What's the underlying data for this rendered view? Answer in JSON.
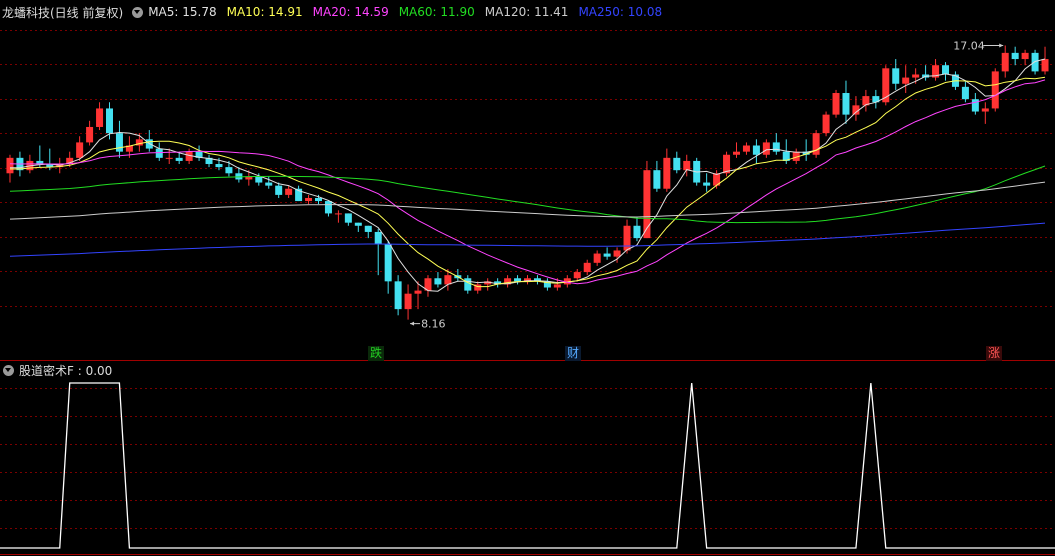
{
  "header": {
    "title": "龙蟠科技(日线 前复权)",
    "ma": [
      {
        "label": "MA5: 15.78",
        "color": "#e0e0e0"
      },
      {
        "label": "MA10: 14.91",
        "color": "#ffff55"
      },
      {
        "label": "MA20: 14.59",
        "color": "#ff44ff"
      },
      {
        "label": "MA60: 11.90",
        "color": "#22dd22"
      },
      {
        "label": "MA120: 11.41",
        "color": "#cccccc"
      },
      {
        "label": "MA250: 10.08",
        "color": "#3344ff"
      }
    ]
  },
  "annotations": {
    "high_label": "17.04",
    "low_label": "8.16"
  },
  "signals": [
    {
      "label": "跌",
      "color": "#22cc22",
      "bg": "#0a2a0a"
    },
    {
      "label": "财",
      "color": "#55aaff",
      "bg": "#0a1a30"
    },
    {
      "label": "涨",
      "color": "#ff5555",
      "bg": "#3a0a0a"
    }
  ],
  "indicator": {
    "title": "股道密术F : 0.00"
  },
  "colors": {
    "up": "#ff3333",
    "down": "#44e0f0",
    "grid": "#7a0000",
    "indicator_line": "#ffffff"
  },
  "chart_data": {
    "type": "candlestick",
    "candles": [
      [
        12.9,
        13.5,
        12.6,
        13.4
      ],
      [
        13.4,
        13.6,
        12.8,
        13.0
      ],
      [
        13.0,
        13.5,
        12.9,
        13.3
      ],
      [
        13.3,
        13.8,
        13.1,
        13.2
      ],
      [
        13.2,
        13.7,
        13.0,
        13.1
      ],
      [
        13.1,
        13.4,
        12.9,
        13.2
      ],
      [
        13.2,
        13.6,
        13.1,
        13.4
      ],
      [
        13.4,
        14.1,
        13.3,
        13.9
      ],
      [
        13.9,
        14.6,
        13.8,
        14.4
      ],
      [
        14.4,
        15.2,
        14.3,
        15.0
      ],
      [
        15.0,
        15.2,
        14.0,
        14.2
      ],
      [
        14.2,
        14.6,
        13.4,
        13.6
      ],
      [
        13.6,
        14.1,
        13.4,
        13.8
      ],
      [
        13.8,
        14.2,
        13.6,
        14.0
      ],
      [
        14.0,
        14.3,
        13.6,
        13.7
      ],
      [
        13.7,
        13.9,
        13.3,
        13.4
      ],
      [
        13.4,
        13.7,
        13.2,
        13.4
      ],
      [
        13.4,
        13.6,
        13.2,
        13.3
      ],
      [
        13.3,
        13.7,
        13.2,
        13.6
      ],
      [
        13.6,
        13.8,
        13.3,
        13.4
      ],
      [
        13.4,
        13.5,
        13.1,
        13.2
      ],
      [
        13.2,
        13.4,
        13.0,
        13.1
      ],
      [
        13.1,
        13.3,
        12.8,
        12.9
      ],
      [
        12.9,
        13.1,
        12.6,
        12.7
      ],
      [
        12.7,
        13.0,
        12.5,
        12.8
      ],
      [
        12.8,
        12.9,
        12.5,
        12.6
      ],
      [
        12.6,
        12.8,
        12.4,
        12.5
      ],
      [
        12.5,
        12.6,
        12.1,
        12.2
      ],
      [
        12.2,
        12.5,
        12.1,
        12.4
      ],
      [
        12.4,
        12.5,
        12.0,
        12.0
      ],
      [
        12.0,
        12.2,
        11.9,
        12.1
      ],
      [
        12.1,
        12.2,
        11.9,
        12.0
      ],
      [
        12.0,
        12.0,
        11.5,
        11.6
      ],
      [
        11.6,
        11.7,
        11.3,
        11.6
      ],
      [
        11.6,
        11.6,
        11.2,
        11.3
      ],
      [
        11.3,
        11.3,
        11.0,
        11.2
      ],
      [
        11.2,
        11.2,
        10.8,
        11.0
      ],
      [
        11.0,
        11.1,
        9.6,
        10.6
      ],
      [
        10.6,
        10.7,
        9.0,
        9.4
      ],
      [
        9.4,
        9.6,
        8.3,
        8.5
      ],
      [
        8.5,
        9.3,
        8.16,
        9.0
      ],
      [
        9.0,
        9.4,
        8.5,
        9.1
      ],
      [
        9.1,
        9.6,
        8.9,
        9.5
      ],
      [
        9.5,
        9.7,
        9.2,
        9.3
      ],
      [
        9.3,
        9.8,
        9.1,
        9.6
      ],
      [
        9.6,
        9.8,
        9.4,
        9.5
      ],
      [
        9.5,
        9.6,
        9.0,
        9.1
      ],
      [
        9.1,
        9.4,
        9.0,
        9.3
      ],
      [
        9.3,
        9.5,
        9.1,
        9.4
      ],
      [
        9.4,
        9.5,
        9.2,
        9.3
      ],
      [
        9.3,
        9.6,
        9.2,
        9.5
      ],
      [
        9.5,
        9.6,
        9.3,
        9.4
      ],
      [
        9.4,
        9.6,
        9.3,
        9.5
      ],
      [
        9.5,
        9.6,
        9.3,
        9.4
      ],
      [
        9.4,
        9.5,
        9.1,
        9.2
      ],
      [
        9.2,
        9.5,
        9.1,
        9.3
      ],
      [
        9.3,
        9.6,
        9.2,
        9.5
      ],
      [
        9.5,
        9.8,
        9.4,
        9.7
      ],
      [
        9.7,
        10.1,
        9.6,
        10.0
      ],
      [
        10.0,
        10.4,
        9.9,
        10.3
      ],
      [
        10.3,
        10.5,
        10.1,
        10.2
      ],
      [
        10.2,
        10.5,
        10.0,
        10.4
      ],
      [
        10.4,
        11.4,
        10.3,
        11.2
      ],
      [
        11.2,
        11.5,
        10.7,
        10.8
      ],
      [
        10.8,
        13.3,
        10.8,
        13.0
      ],
      [
        13.0,
        13.3,
        12.3,
        12.4
      ],
      [
        12.4,
        13.7,
        12.3,
        13.4
      ],
      [
        13.4,
        13.6,
        12.9,
        13.0
      ],
      [
        13.0,
        13.5,
        12.8,
        13.3
      ],
      [
        13.3,
        13.4,
        12.5,
        12.6
      ],
      [
        12.6,
        12.9,
        12.3,
        12.5
      ],
      [
        12.5,
        13.0,
        12.4,
        12.9
      ],
      [
        12.9,
        13.6,
        12.8,
        13.5
      ],
      [
        13.5,
        13.9,
        13.4,
        13.6
      ],
      [
        13.6,
        13.9,
        13.5,
        13.8
      ],
      [
        13.8,
        14.0,
        13.2,
        13.5
      ],
      [
        13.5,
        14.0,
        13.4,
        13.9
      ],
      [
        13.9,
        14.2,
        13.5,
        13.6
      ],
      [
        13.6,
        14.0,
        13.2,
        13.3
      ],
      [
        13.3,
        13.7,
        13.2,
        13.6
      ],
      [
        13.6,
        14.0,
        13.3,
        13.5
      ],
      [
        13.5,
        14.3,
        13.4,
        14.2
      ],
      [
        14.2,
        14.9,
        14.1,
        14.8
      ],
      [
        14.8,
        15.6,
        14.7,
        15.5
      ],
      [
        15.5,
        15.9,
        14.5,
        14.8
      ],
      [
        14.8,
        15.4,
        14.6,
        15.1
      ],
      [
        15.1,
        15.6,
        14.9,
        15.4
      ],
      [
        15.4,
        15.6,
        15.0,
        15.2
      ],
      [
        15.2,
        16.4,
        15.1,
        16.3
      ],
      [
        16.3,
        16.6,
        15.6,
        15.8
      ],
      [
        15.8,
        16.4,
        15.5,
        16.0
      ],
      [
        16.0,
        16.3,
        15.8,
        16.1
      ],
      [
        16.1,
        16.4,
        15.9,
        16.0
      ],
      [
        16.0,
        16.6,
        15.9,
        16.4
      ],
      [
        16.4,
        16.5,
        15.9,
        16.1
      ],
      [
        16.1,
        16.2,
        15.6,
        15.7
      ],
      [
        15.7,
        15.9,
        15.2,
        15.3
      ],
      [
        15.3,
        15.5,
        14.8,
        14.9
      ],
      [
        14.9,
        15.2,
        14.5,
        15.0
      ],
      [
        15.0,
        16.3,
        14.9,
        16.2
      ],
      [
        16.2,
        17.04,
        16.0,
        16.8
      ],
      [
        16.8,
        17.0,
        16.4,
        16.6
      ],
      [
        16.6,
        16.9,
        16.4,
        16.8
      ],
      [
        16.8,
        16.9,
        16.1,
        16.2
      ],
      [
        16.2,
        17.0,
        16.1,
        16.6
      ]
    ],
    "indicator_pulses": [
      {
        "start": 5,
        "end": 12
      },
      {
        "start": 67,
        "end": 70
      },
      {
        "start": 85,
        "end": 88
      }
    ],
    "ylim": [
      7.5,
      17.8
    ]
  }
}
